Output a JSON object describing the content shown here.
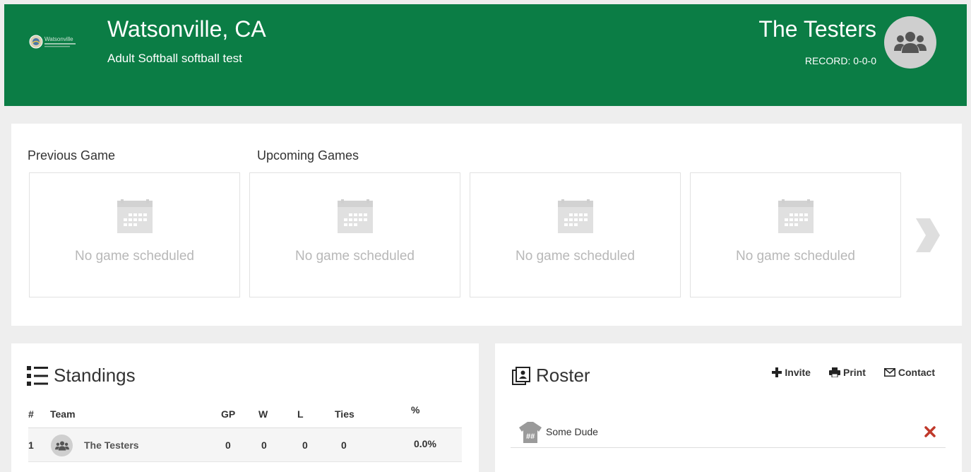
{
  "header": {
    "logo_text": "Watsonville",
    "league_title": "Watsonville, CA",
    "league_subtitle": "Adult Softball softball test",
    "team_name": "The Testers",
    "record": "RECORD: 0-0-0"
  },
  "games": {
    "previous_label": "Previous Game",
    "upcoming_label": "Upcoming Games",
    "boxes": [
      {
        "text": "No game scheduled"
      },
      {
        "text": "No game scheduled"
      },
      {
        "text": "No game scheduled"
      },
      {
        "text": "No game scheduled"
      }
    ]
  },
  "standings": {
    "title": "Standings",
    "headers": {
      "rank": "#",
      "team": "Team",
      "gp": "GP",
      "w": "W",
      "l": "L",
      "ties": "Ties",
      "pct": "%"
    },
    "rows": [
      {
        "rank": "1",
        "team": "The Testers",
        "gp": "0",
        "w": "0",
        "l": "0",
        "ties": "0",
        "pct": "0.0%"
      }
    ]
  },
  "roster": {
    "title": "Roster",
    "actions": {
      "invite": "Invite",
      "print": "Print",
      "contact": "Contact"
    },
    "players": [
      {
        "jersey": "##",
        "name": "Some Dude"
      }
    ]
  },
  "colors": {
    "header_green": "#0b7d45",
    "remove_red": "#c0392b",
    "muted_gray": "#b8b8b8"
  },
  "icons": [
    "users-icon",
    "calendar-icon",
    "chevron-right-icon",
    "list-icon",
    "portrait-icon",
    "plus-icon",
    "print-icon",
    "envelope-icon",
    "jersey-icon",
    "close-icon"
  ]
}
